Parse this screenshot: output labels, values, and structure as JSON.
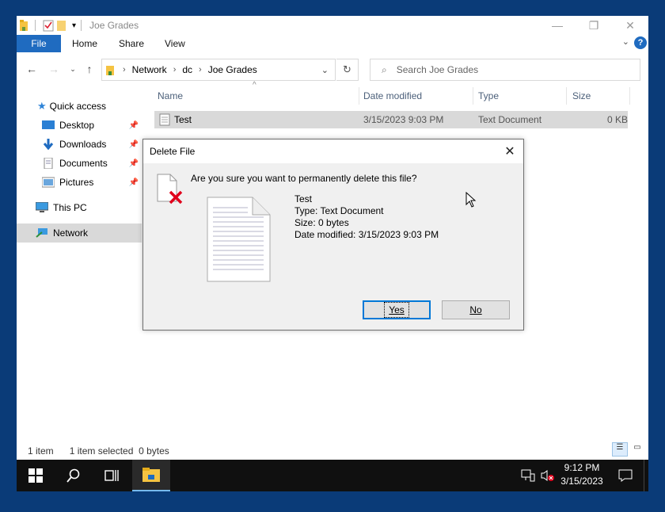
{
  "window": {
    "title": "Joe Grades",
    "ribbon_tabs": [
      "File",
      "Home",
      "Share",
      "View"
    ],
    "help": "?"
  },
  "address": {
    "crumbs": [
      "Network",
      "dc",
      "Joe Grades"
    ],
    "search_placeholder": "Search Joe Grades"
  },
  "sidebar": {
    "items": [
      {
        "label": "Quick access"
      },
      {
        "label": "Desktop"
      },
      {
        "label": "Downloads"
      },
      {
        "label": "Documents"
      },
      {
        "label": "Pictures"
      },
      {
        "label": "This PC"
      },
      {
        "label": "Network"
      }
    ]
  },
  "columns": [
    "Name",
    "Date modified",
    "Type",
    "Size"
  ],
  "files": [
    {
      "name": "Test",
      "date": "3/15/2023 9:03 PM",
      "type": "Text Document",
      "size": "0 KB"
    }
  ],
  "status": {
    "count": "1 item",
    "selected": "1 item selected  0 bytes"
  },
  "dialog": {
    "title": "Delete File",
    "question": "Are you sure you want to permanently delete this file?",
    "file_name": "Test",
    "file_type": "Type: Text Document",
    "file_size": "Size: 0 bytes",
    "file_date": "Date modified: 3/15/2023 9:03 PM",
    "yes": "Yes",
    "no": "No"
  },
  "taskbar": {
    "time": "9:12 PM",
    "date": "3/15/2023"
  },
  "colors": {
    "desktop": "#0a3b78",
    "accent": "#1f6bc0",
    "selection": "#d9d9d9",
    "delete_x": "#e0001b"
  }
}
